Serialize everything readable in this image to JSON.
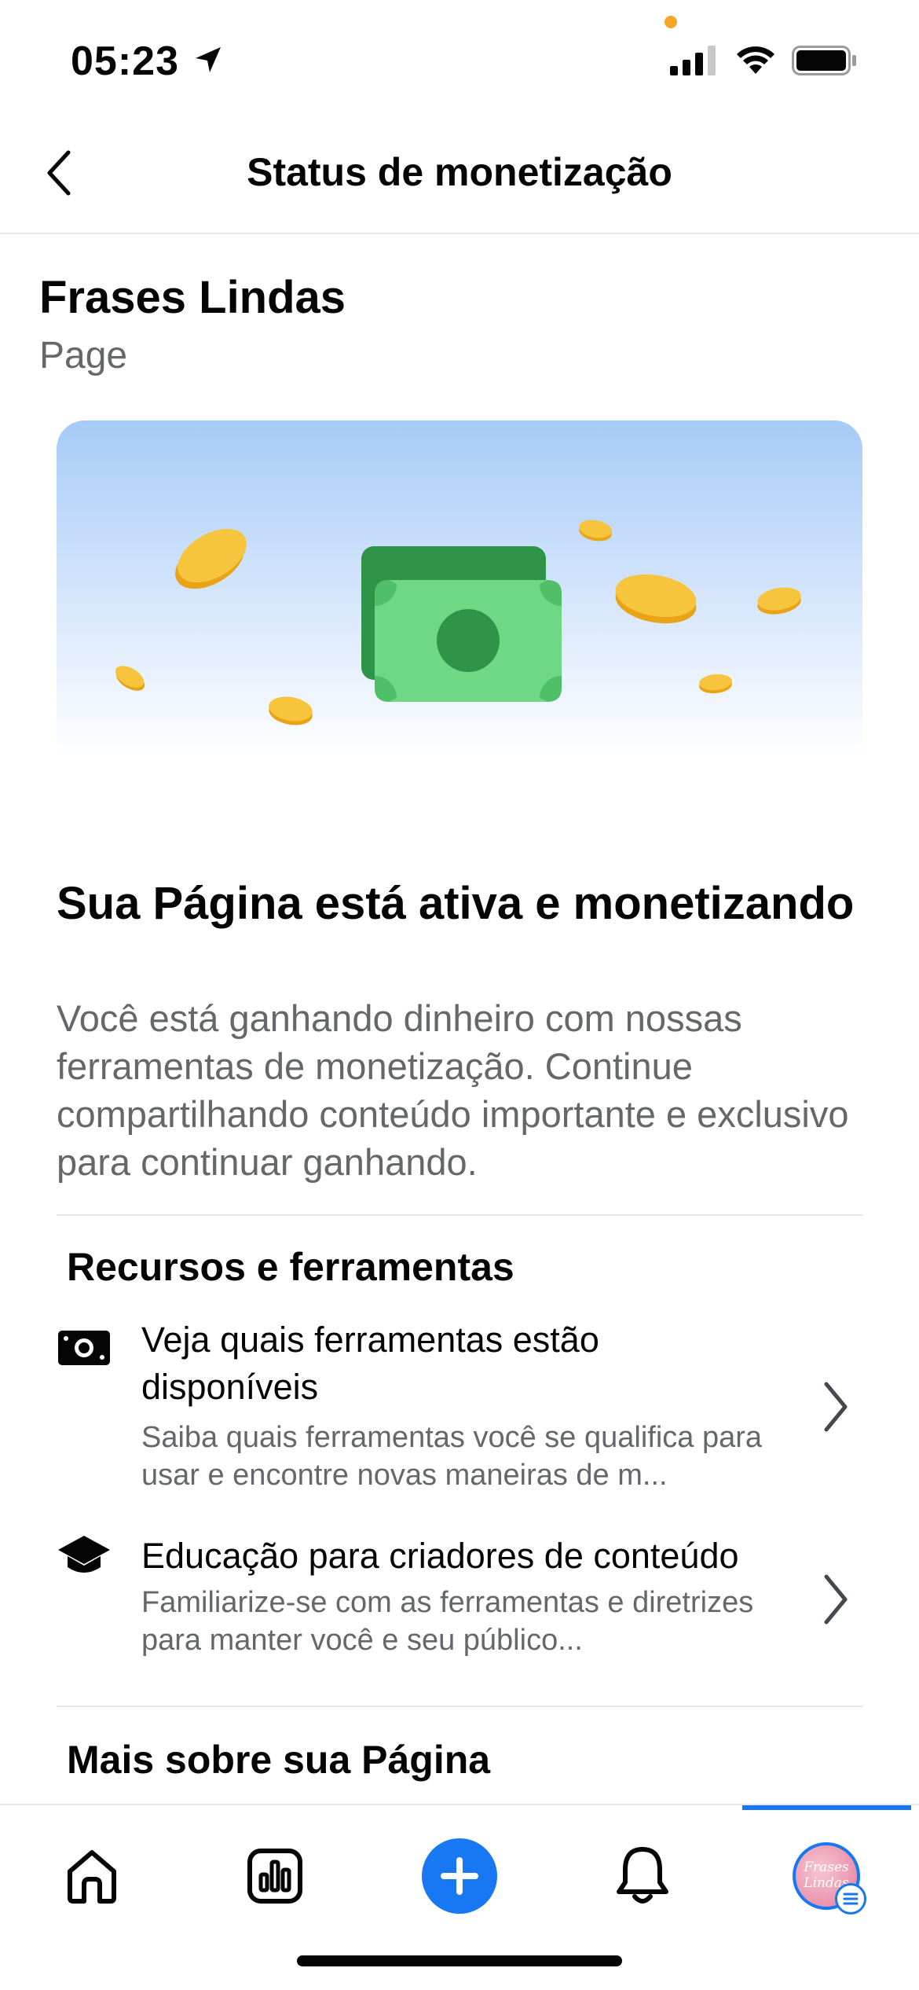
{
  "status_bar": {
    "time": "05:23"
  },
  "header": {
    "title": "Status de monetização"
  },
  "page": {
    "name": "Frases Lindas",
    "type": "Page"
  },
  "status": {
    "title": "Sua Página está ativa e monetizando",
    "description": "Você está ganhando dinheiro com nossas ferramentas de monetização. Continue compartilhando conteúdo importante e exclusivo para continuar ganhando."
  },
  "resources": {
    "section_title": "Recursos e ferramentas",
    "items": [
      {
        "icon": "money-icon",
        "title": "Veja quais ferramentas estão disponíveis",
        "description": "Saiba quais ferramentas você se qualifica para usar e encontre novas maneiras de m..."
      },
      {
        "icon": "graduation-cap-icon",
        "title": "Educação para criadores de conteúdo",
        "description": "Familiarize-se com as ferramentas e diretrizes para manter você e seu público..."
      }
    ]
  },
  "more": {
    "section_title": "Mais sobre sua Página"
  },
  "avatar": {
    "text": "Frases Lindas"
  },
  "bottom_nav": {
    "items": [
      "home-icon",
      "insights-icon",
      "create-plus-icon",
      "notifications-bell-icon",
      "profile-avatar"
    ],
    "active_index": 4
  },
  "colors": {
    "accent": "#1877f2",
    "text_primary": "#050505",
    "text_secondary": "#65676b",
    "coin": "#f5b82e",
    "cash": "#5ccc6e"
  }
}
